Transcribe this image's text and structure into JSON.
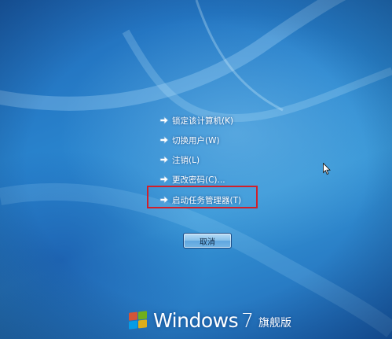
{
  "security_options": {
    "items": [
      {
        "label": "锁定该计算机(K)",
        "icon": "arrow-right-icon"
      },
      {
        "label": "切换用户(W)",
        "icon": "arrow-right-icon"
      },
      {
        "label": "注销(L)",
        "icon": "arrow-right-icon"
      },
      {
        "label": "更改密码(C)...",
        "icon": "arrow-right-icon"
      },
      {
        "label": "启动任务管理器(T)",
        "icon": "arrow-right-icon"
      }
    ],
    "highlighted_item": "启动任务管理器(T)",
    "highlight_color": "#d0202a"
  },
  "cancel_button": {
    "label": "取消"
  },
  "branding": {
    "name": "Windows",
    "version": "7",
    "edition": "旗舰版"
  },
  "colors": {
    "background": "#2a86cf",
    "text": "#ffffff"
  }
}
